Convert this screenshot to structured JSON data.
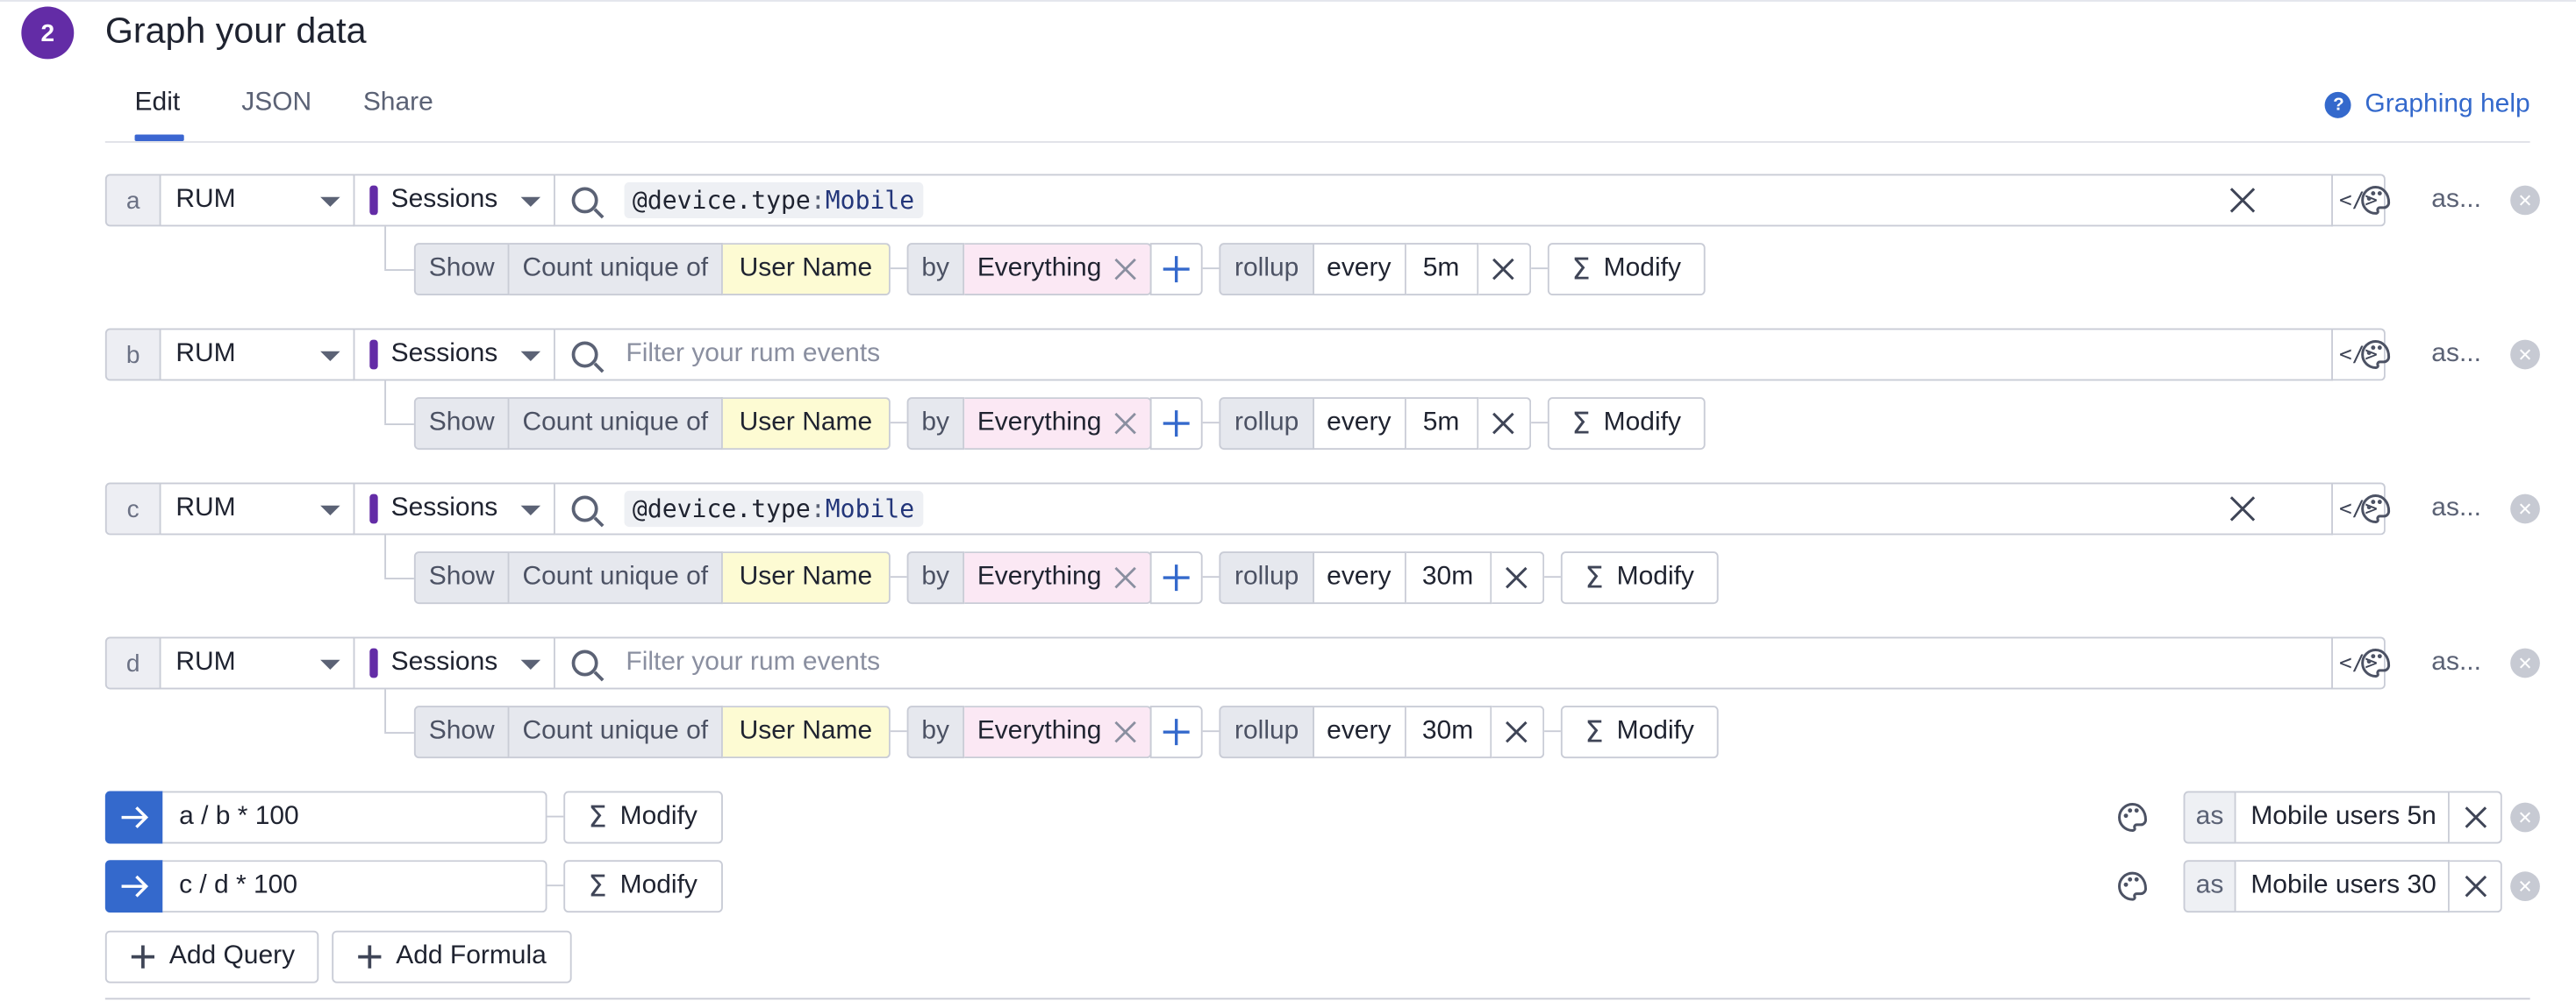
{
  "section": {
    "step": "2",
    "title": "Graph your data"
  },
  "tabs": [
    "Edit",
    "JSON",
    "Share"
  ],
  "help": {
    "label": "Graphing help"
  },
  "queries": [
    {
      "letter": "a",
      "source": "RUM",
      "dataset": "Sessions",
      "query_key": "@device.type",
      "query_value": "Mobile",
      "placeholder": "",
      "show": "Show",
      "aggregation": "Count unique of",
      "measure": "User Name",
      "by": "by",
      "group": "Everything",
      "rollup": "rollup",
      "every": "every",
      "interval": "5m",
      "modify": "Modify",
      "as": "as..."
    },
    {
      "letter": "b",
      "source": "RUM",
      "dataset": "Sessions",
      "query_key": "",
      "query_value": "",
      "placeholder": "Filter your rum events",
      "show": "Show",
      "aggregation": "Count unique of",
      "measure": "User Name",
      "by": "by",
      "group": "Everything",
      "rollup": "rollup",
      "every": "every",
      "interval": "5m",
      "modify": "Modify",
      "as": "as..."
    },
    {
      "letter": "c",
      "source": "RUM",
      "dataset": "Sessions",
      "query_key": "@device.type",
      "query_value": "Mobile",
      "placeholder": "",
      "show": "Show",
      "aggregation": "Count unique of",
      "measure": "User Name",
      "by": "by",
      "group": "Everything",
      "rollup": "rollup",
      "every": "every",
      "interval": "30m",
      "modify": "Modify",
      "as": "as..."
    },
    {
      "letter": "d",
      "source": "RUM",
      "dataset": "Sessions",
      "query_key": "",
      "query_value": "",
      "placeholder": "Filter your rum events",
      "show": "Show",
      "aggregation": "Count unique of",
      "measure": "User Name",
      "by": "by",
      "group": "Everything",
      "rollup": "rollup",
      "every": "every",
      "interval": "30m",
      "modify": "Modify",
      "as": "as..."
    }
  ],
  "formulas": [
    {
      "expression": "a / b * 100",
      "modify": "Modify",
      "as": "as",
      "alias": "Mobile users 5n"
    },
    {
      "expression": "c / d * 100",
      "modify": "Modify",
      "as": "as",
      "alias": "Mobile users 30"
    }
  ],
  "actions": {
    "add_query": "Add Query",
    "add_formula": "Add Formula"
  },
  "colors": {
    "accent": "#632ca6",
    "link": "#3469cc",
    "measure_bg": "#fdfbd3",
    "group_bg": "#fbe8f4"
  }
}
